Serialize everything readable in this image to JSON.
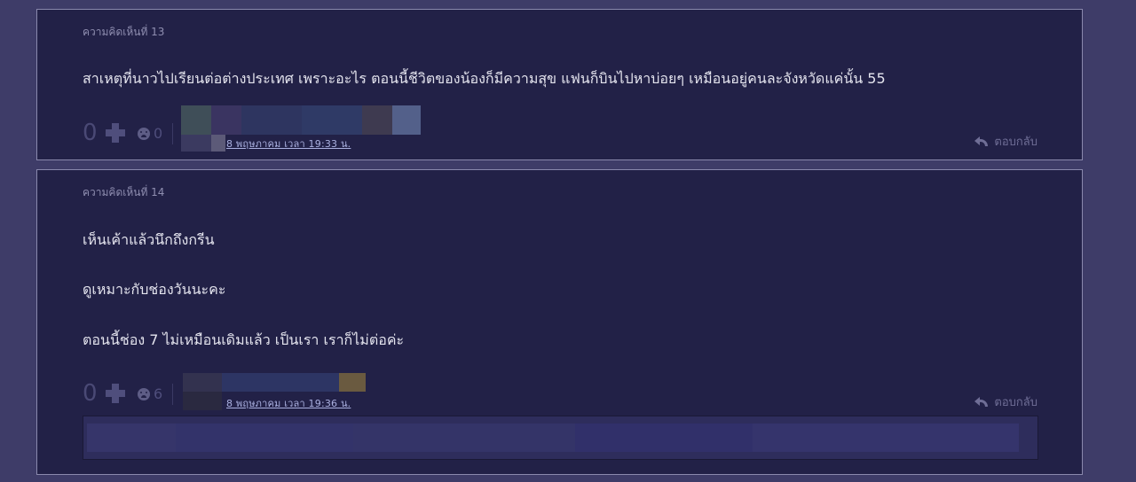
{
  "comments": [
    {
      "number_label": "ความคิดเห็นที่ 13",
      "lines": [
        "สาเหตุที่นาวไปเรียนต่อต่างประเทศ เพราะอะไร ตอนนี้ชีวิตของน้องก็มีความสุข แฟนก็บินไปหาบ่อยๆ เหมือนอยู่คนละจังหวัดแค่นั้น 55"
      ],
      "vote_count": "0",
      "emotion_count": "0",
      "timestamp": "8 พฤษภาคม เวลา 19:33 น.",
      "reply_label": "ตอบกลับ"
    },
    {
      "number_label": "ความคิดเห็นที่ 14",
      "lines": [
        "เห็นเค้าแล้วนึกถึงกรีน",
        "ดูเหมาะกับช่องวันนะคะ",
        "ตอนนี้ช่อง 7 ไม่เหมือนเดิมแล้ว เป็นเรา เราก็ไม่ต่อค่ะ"
      ],
      "vote_count": "0",
      "emotion_count": "6",
      "timestamp": "8 พฤษภาคม เวลา 19:36 น.",
      "reply_label": "ตอบกลับ"
    }
  ],
  "icons": {
    "vote": "plus-icon",
    "emotion": "emoticon-icon",
    "reply": "reply-icon"
  },
  "colors": {
    "page_bg": "#3e3c68",
    "card_bg": "#222147",
    "card_border": "#8a89ad",
    "text": "#e4e4ee",
    "muted": "#8f8eb0",
    "link": "#aab0e0"
  }
}
